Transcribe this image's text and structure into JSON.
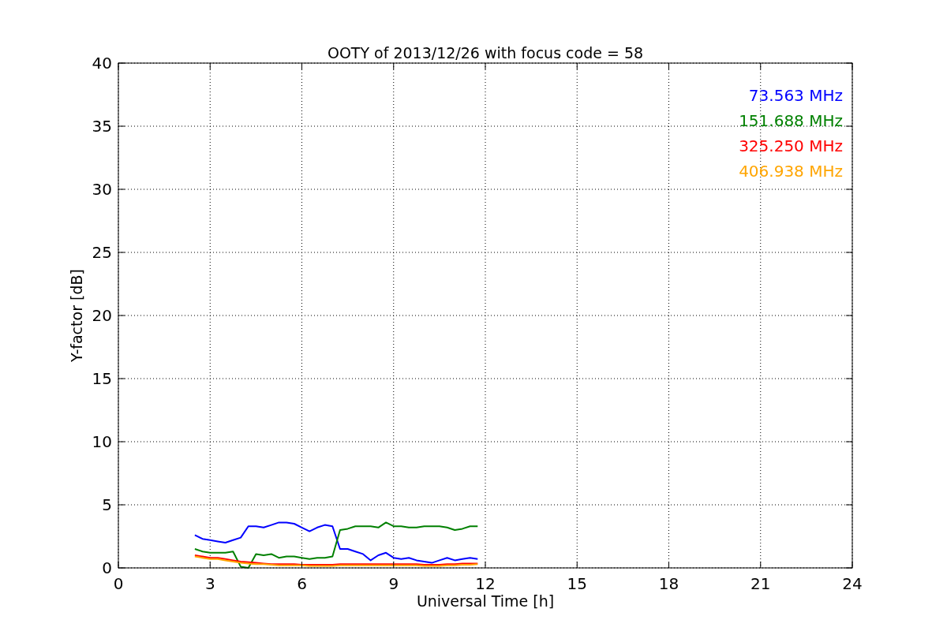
{
  "chart_data": {
    "type": "line",
    "title": "OOTY of 2013/12/26 with focus code = 58",
    "xlabel": "Universal Time [h]",
    "ylabel": "Y-factor [dB]",
    "x": [
      2.5,
      2.75,
      3,
      3.25,
      3.5,
      3.75,
      4,
      4.25,
      4.5,
      4.75,
      5,
      5.25,
      5.5,
      5.75,
      6,
      6.25,
      6.5,
      6.75,
      7,
      7.25,
      7.5,
      7.75,
      8,
      8.25,
      8.5,
      8.75,
      9,
      9.25,
      9.5,
      9.75,
      10,
      10.25,
      10.5,
      10.75,
      11,
      11.25,
      11.5,
      11.75
    ],
    "series": [
      {
        "name": "73.563 MHz",
        "color": "#0000ff",
        "values": [
          2.6,
          2.3,
          2.2,
          2.1,
          2.0,
          2.2,
          2.4,
          3.3,
          3.3,
          3.2,
          3.4,
          3.6,
          3.6,
          3.5,
          3.2,
          2.9,
          3.2,
          3.4,
          3.3,
          1.5,
          1.5,
          1.3,
          1.1,
          0.6,
          1.0,
          1.2,
          0.8,
          0.7,
          0.8,
          0.6,
          0.5,
          0.4,
          0.6,
          0.8,
          0.6,
          0.7,
          0.8,
          0.7
        ]
      },
      {
        "name": "151.688 MHz",
        "color": "#008000",
        "values": [
          1.5,
          1.3,
          1.2,
          1.2,
          1.2,
          1.3,
          0.1,
          0.0,
          1.1,
          1.0,
          1.1,
          0.8,
          0.9,
          0.9,
          0.8,
          0.7,
          0.8,
          0.8,
          0.9,
          3.0,
          3.1,
          3.3,
          3.3,
          3.3,
          3.2,
          3.6,
          3.3,
          3.3,
          3.2,
          3.2,
          3.3,
          3.3,
          3.3,
          3.2,
          3.0,
          3.1,
          3.3,
          3.3
        ]
      },
      {
        "name": "325.250 MHz",
        "color": "#ff0000",
        "values": [
          1.0,
          0.9,
          0.8,
          0.8,
          0.7,
          0.6,
          0.5,
          0.45,
          0.4,
          0.35,
          0.3,
          0.3,
          0.3,
          0.3,
          0.25,
          0.25,
          0.25,
          0.25,
          0.25,
          0.3,
          0.3,
          0.3,
          0.3,
          0.3,
          0.3,
          0.3,
          0.3,
          0.3,
          0.3,
          0.3,
          0.25,
          0.25,
          0.25,
          0.3,
          0.3,
          0.35,
          0.35,
          0.35
        ]
      },
      {
        "name": "406.938 MHz",
        "color": "#ffa500",
        "values": [
          0.9,
          0.8,
          0.7,
          0.7,
          0.6,
          0.5,
          0.4,
          0.35,
          0.3,
          0.3,
          0.25,
          0.2,
          0.2,
          0.2,
          0.2,
          0.15,
          0.15,
          0.15,
          0.15,
          0.2,
          0.2,
          0.2,
          0.2,
          0.2,
          0.2,
          0.2,
          0.2,
          0.2,
          0.2,
          0.2,
          0.15,
          0.15,
          0.15,
          0.2,
          0.2,
          0.25,
          0.25,
          0.3
        ]
      }
    ],
    "grid": true,
    "xlim": [
      0,
      24
    ],
    "ylim": [
      0,
      40
    ],
    "xticks": [
      0,
      3,
      6,
      9,
      12,
      15,
      18,
      21,
      24
    ],
    "yticks": [
      0,
      5,
      10,
      15,
      20,
      25,
      30,
      35,
      40
    ]
  }
}
